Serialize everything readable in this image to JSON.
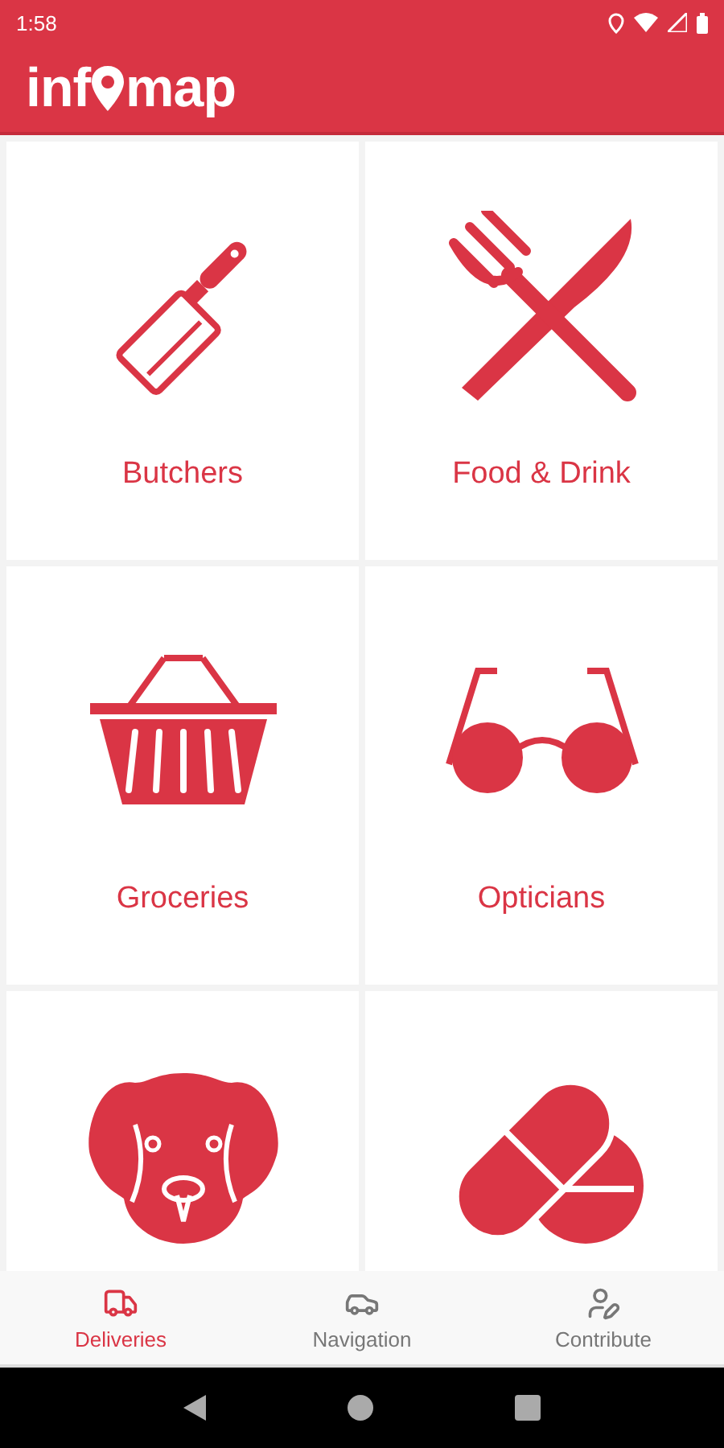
{
  "status_bar": {
    "time": "1:58"
  },
  "app_bar": {
    "logo_left": "inf",
    "logo_right": "map"
  },
  "categories": [
    {
      "kind": "labeled",
      "label": "Butchers"
    },
    {
      "kind": "labeled",
      "label": "Food & Drink"
    },
    {
      "kind": "labeled",
      "label": "Groceries"
    },
    {
      "kind": "labeled",
      "label": "Opticians"
    },
    {
      "kind": "icon_only"
    },
    {
      "kind": "icon_only"
    }
  ],
  "bottom_nav": [
    {
      "label": "Deliveries",
      "selected": true
    },
    {
      "label": "Navigation",
      "selected": false
    },
    {
      "label": "Contribute",
      "selected": false
    }
  ]
}
